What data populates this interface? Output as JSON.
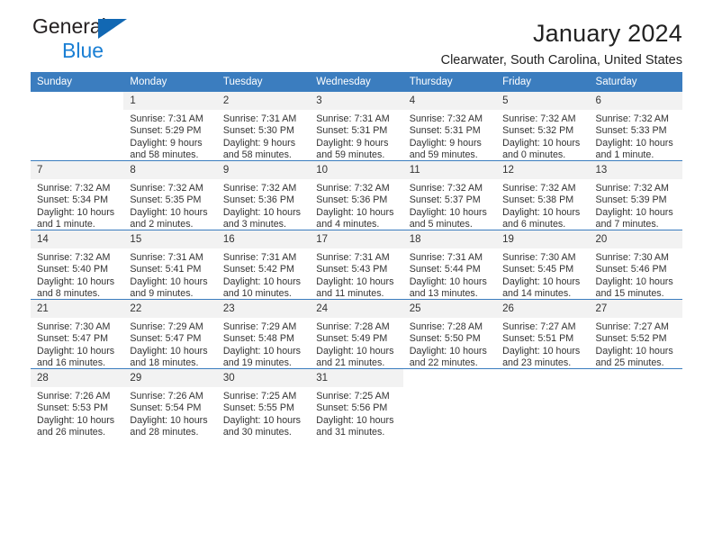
{
  "brand": {
    "word1": "General",
    "word2": "Blue",
    "triangle_color": "#1268b3",
    "blue_text_color": "#1a7fd4"
  },
  "header": {
    "title": "January 2024",
    "subtitle": "Clearwater, South Carolina, United States"
  },
  "calendar": {
    "header_bg": "#3b7dbf",
    "daynum_bg": "#f2f2f2",
    "weekday_headers": [
      "Sunday",
      "Monday",
      "Tuesday",
      "Wednesday",
      "Thursday",
      "Friday",
      "Saturday"
    ],
    "weeks": [
      [
        {
          "day": "",
          "sunrise": "",
          "sunset": "",
          "daylight1": "",
          "daylight2": "",
          "blank": true
        },
        {
          "day": "1",
          "sunrise": "Sunrise: 7:31 AM",
          "sunset": "Sunset: 5:29 PM",
          "daylight1": "Daylight: 9 hours",
          "daylight2": "and 58 minutes."
        },
        {
          "day": "2",
          "sunrise": "Sunrise: 7:31 AM",
          "sunset": "Sunset: 5:30 PM",
          "daylight1": "Daylight: 9 hours",
          "daylight2": "and 58 minutes."
        },
        {
          "day": "3",
          "sunrise": "Sunrise: 7:31 AM",
          "sunset": "Sunset: 5:31 PM",
          "daylight1": "Daylight: 9 hours",
          "daylight2": "and 59 minutes."
        },
        {
          "day": "4",
          "sunrise": "Sunrise: 7:32 AM",
          "sunset": "Sunset: 5:31 PM",
          "daylight1": "Daylight: 9 hours",
          "daylight2": "and 59 minutes."
        },
        {
          "day": "5",
          "sunrise": "Sunrise: 7:32 AM",
          "sunset": "Sunset: 5:32 PM",
          "daylight1": "Daylight: 10 hours",
          "daylight2": "and 0 minutes."
        },
        {
          "day": "6",
          "sunrise": "Sunrise: 7:32 AM",
          "sunset": "Sunset: 5:33 PM",
          "daylight1": "Daylight: 10 hours",
          "daylight2": "and 1 minute."
        }
      ],
      [
        {
          "day": "7",
          "sunrise": "Sunrise: 7:32 AM",
          "sunset": "Sunset: 5:34 PM",
          "daylight1": "Daylight: 10 hours",
          "daylight2": "and 1 minute."
        },
        {
          "day": "8",
          "sunrise": "Sunrise: 7:32 AM",
          "sunset": "Sunset: 5:35 PM",
          "daylight1": "Daylight: 10 hours",
          "daylight2": "and 2 minutes."
        },
        {
          "day": "9",
          "sunrise": "Sunrise: 7:32 AM",
          "sunset": "Sunset: 5:36 PM",
          "daylight1": "Daylight: 10 hours",
          "daylight2": "and 3 minutes."
        },
        {
          "day": "10",
          "sunrise": "Sunrise: 7:32 AM",
          "sunset": "Sunset: 5:36 PM",
          "daylight1": "Daylight: 10 hours",
          "daylight2": "and 4 minutes."
        },
        {
          "day": "11",
          "sunrise": "Sunrise: 7:32 AM",
          "sunset": "Sunset: 5:37 PM",
          "daylight1": "Daylight: 10 hours",
          "daylight2": "and 5 minutes."
        },
        {
          "day": "12",
          "sunrise": "Sunrise: 7:32 AM",
          "sunset": "Sunset: 5:38 PM",
          "daylight1": "Daylight: 10 hours",
          "daylight2": "and 6 minutes."
        },
        {
          "day": "13",
          "sunrise": "Sunrise: 7:32 AM",
          "sunset": "Sunset: 5:39 PM",
          "daylight1": "Daylight: 10 hours",
          "daylight2": "and 7 minutes."
        }
      ],
      [
        {
          "day": "14",
          "sunrise": "Sunrise: 7:32 AM",
          "sunset": "Sunset: 5:40 PM",
          "daylight1": "Daylight: 10 hours",
          "daylight2": "and 8 minutes."
        },
        {
          "day": "15",
          "sunrise": "Sunrise: 7:31 AM",
          "sunset": "Sunset: 5:41 PM",
          "daylight1": "Daylight: 10 hours",
          "daylight2": "and 9 minutes."
        },
        {
          "day": "16",
          "sunrise": "Sunrise: 7:31 AM",
          "sunset": "Sunset: 5:42 PM",
          "daylight1": "Daylight: 10 hours",
          "daylight2": "and 10 minutes."
        },
        {
          "day": "17",
          "sunrise": "Sunrise: 7:31 AM",
          "sunset": "Sunset: 5:43 PM",
          "daylight1": "Daylight: 10 hours",
          "daylight2": "and 11 minutes."
        },
        {
          "day": "18",
          "sunrise": "Sunrise: 7:31 AM",
          "sunset": "Sunset: 5:44 PM",
          "daylight1": "Daylight: 10 hours",
          "daylight2": "and 13 minutes."
        },
        {
          "day": "19",
          "sunrise": "Sunrise: 7:30 AM",
          "sunset": "Sunset: 5:45 PM",
          "daylight1": "Daylight: 10 hours",
          "daylight2": "and 14 minutes."
        },
        {
          "day": "20",
          "sunrise": "Sunrise: 7:30 AM",
          "sunset": "Sunset: 5:46 PM",
          "daylight1": "Daylight: 10 hours",
          "daylight2": "and 15 minutes."
        }
      ],
      [
        {
          "day": "21",
          "sunrise": "Sunrise: 7:30 AM",
          "sunset": "Sunset: 5:47 PM",
          "daylight1": "Daylight: 10 hours",
          "daylight2": "and 16 minutes."
        },
        {
          "day": "22",
          "sunrise": "Sunrise: 7:29 AM",
          "sunset": "Sunset: 5:47 PM",
          "daylight1": "Daylight: 10 hours",
          "daylight2": "and 18 minutes."
        },
        {
          "day": "23",
          "sunrise": "Sunrise: 7:29 AM",
          "sunset": "Sunset: 5:48 PM",
          "daylight1": "Daylight: 10 hours",
          "daylight2": "and 19 minutes."
        },
        {
          "day": "24",
          "sunrise": "Sunrise: 7:28 AM",
          "sunset": "Sunset: 5:49 PM",
          "daylight1": "Daylight: 10 hours",
          "daylight2": "and 21 minutes."
        },
        {
          "day": "25",
          "sunrise": "Sunrise: 7:28 AM",
          "sunset": "Sunset: 5:50 PM",
          "daylight1": "Daylight: 10 hours",
          "daylight2": "and 22 minutes."
        },
        {
          "day": "26",
          "sunrise": "Sunrise: 7:27 AM",
          "sunset": "Sunset: 5:51 PM",
          "daylight1": "Daylight: 10 hours",
          "daylight2": "and 23 minutes."
        },
        {
          "day": "27",
          "sunrise": "Sunrise: 7:27 AM",
          "sunset": "Sunset: 5:52 PM",
          "daylight1": "Daylight: 10 hours",
          "daylight2": "and 25 minutes."
        }
      ],
      [
        {
          "day": "28",
          "sunrise": "Sunrise: 7:26 AM",
          "sunset": "Sunset: 5:53 PM",
          "daylight1": "Daylight: 10 hours",
          "daylight2": "and 26 minutes."
        },
        {
          "day": "29",
          "sunrise": "Sunrise: 7:26 AM",
          "sunset": "Sunset: 5:54 PM",
          "daylight1": "Daylight: 10 hours",
          "daylight2": "and 28 minutes."
        },
        {
          "day": "30",
          "sunrise": "Sunrise: 7:25 AM",
          "sunset": "Sunset: 5:55 PM",
          "daylight1": "Daylight: 10 hours",
          "daylight2": "and 30 minutes."
        },
        {
          "day": "31",
          "sunrise": "Sunrise: 7:25 AM",
          "sunset": "Sunset: 5:56 PM",
          "daylight1": "Daylight: 10 hours",
          "daylight2": "and 31 minutes."
        },
        {
          "day": "",
          "sunrise": "",
          "sunset": "",
          "daylight1": "",
          "daylight2": "",
          "blank": true
        },
        {
          "day": "",
          "sunrise": "",
          "sunset": "",
          "daylight1": "",
          "daylight2": "",
          "blank": true
        },
        {
          "day": "",
          "sunrise": "",
          "sunset": "",
          "daylight1": "",
          "daylight2": "",
          "blank": true
        }
      ]
    ]
  }
}
